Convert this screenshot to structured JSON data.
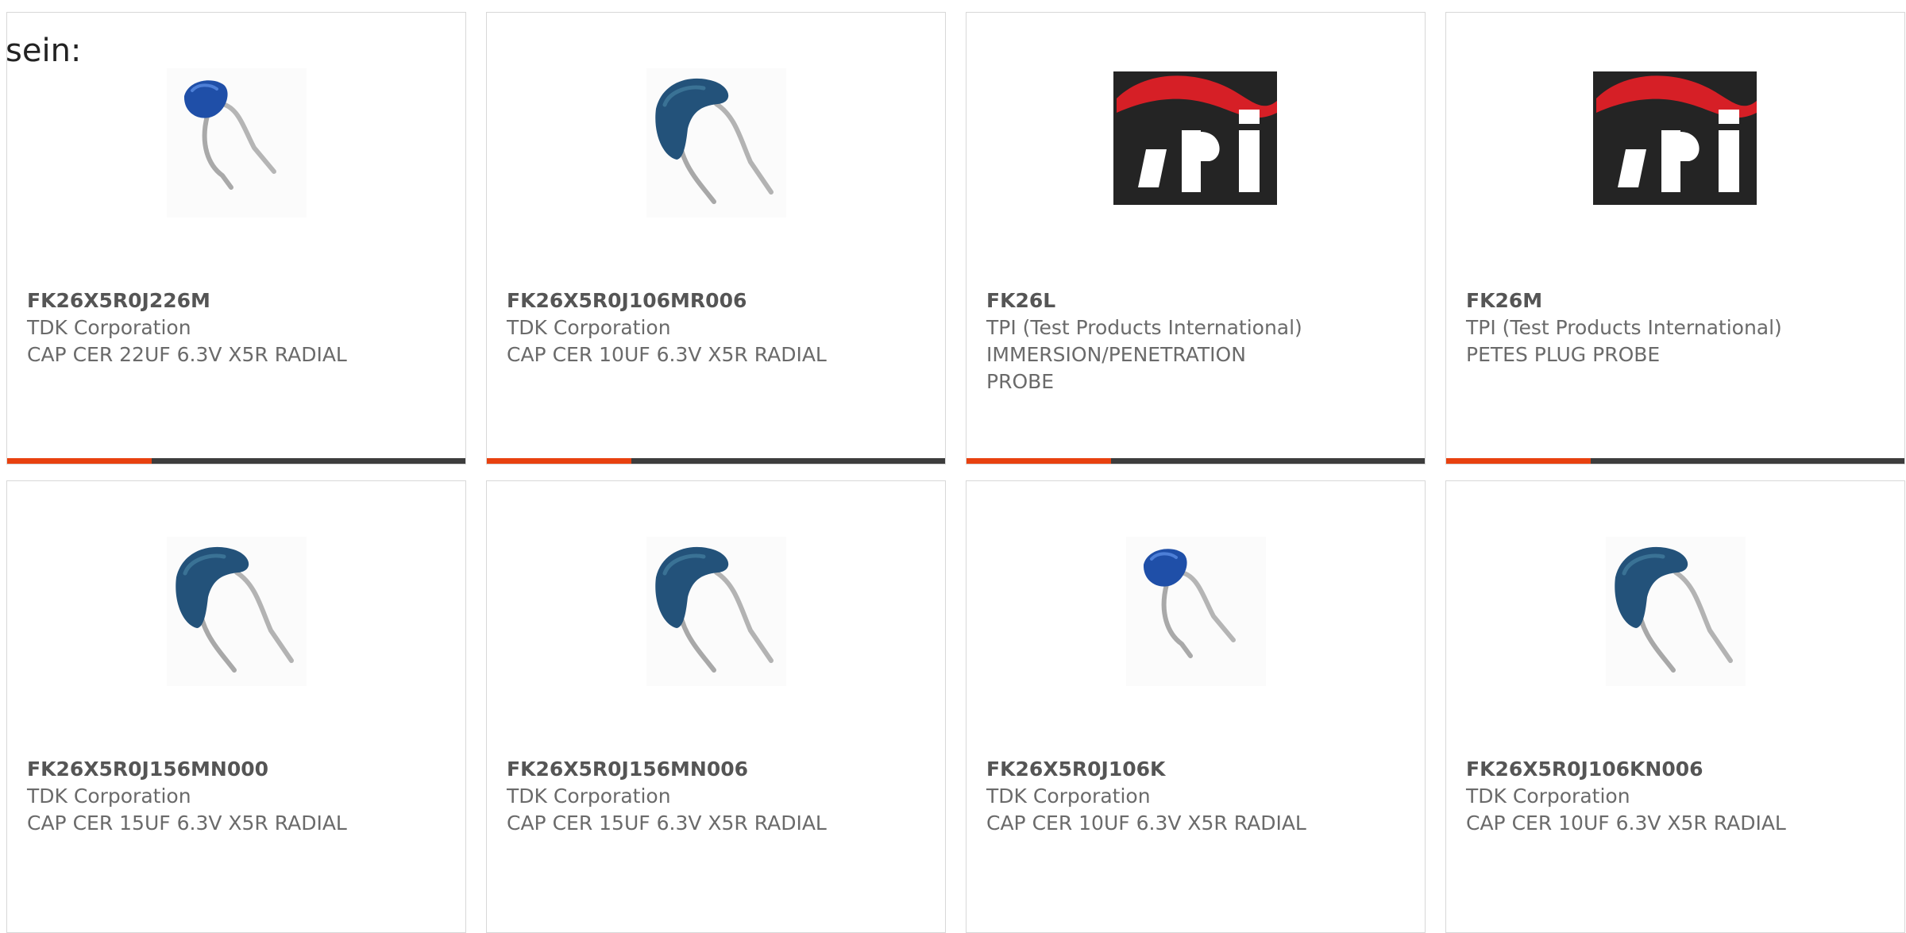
{
  "page": {
    "lead_text": "sein:"
  },
  "colors": {
    "accent": "#e8410f",
    "bar_track": "#3d3d3d",
    "capacitor_blue": "#1f4fa8",
    "capacitor_teal": "#23527a",
    "tpi_red": "#d61f26"
  },
  "products": [
    {
      "part_number": "FK26X5R0J226M",
      "manufacturer": "TDK Corporation",
      "description": [
        "CAP CER 22UF 6.3V X5R RADIAL"
      ],
      "image": "blue-radial-capacitor-small"
    },
    {
      "part_number": "FK26X5R0J106MR006",
      "manufacturer": "TDK Corporation",
      "description": [
        "CAP CER 10UF 6.3V X5R RADIAL"
      ],
      "image": "teal-radial-capacitor"
    },
    {
      "part_number": "FK26L",
      "manufacturer": "TPI (Test Products International)",
      "description": [
        "IMMERSION/PENETRATION",
        "PROBE"
      ],
      "image": "tpi-logo"
    },
    {
      "part_number": "FK26M",
      "manufacturer": "TPI (Test Products International)",
      "description": [
        "PETES PLUG PROBE"
      ],
      "image": "tpi-logo"
    },
    {
      "part_number": "FK26X5R0J156MN000",
      "manufacturer": "TDK Corporation",
      "description": [
        "CAP CER 15UF 6.3V X5R RADIAL"
      ],
      "image": "teal-radial-capacitor"
    },
    {
      "part_number": "FK26X5R0J156MN006",
      "manufacturer": "TDK Corporation",
      "description": [
        "CAP CER 15UF 6.3V X5R RADIAL"
      ],
      "image": "teal-radial-capacitor"
    },
    {
      "part_number": "FK26X5R0J106K",
      "manufacturer": "TDK Corporation",
      "description": [
        "CAP CER 10UF 6.3V X5R RADIAL"
      ],
      "image": "blue-radial-capacitor-small"
    },
    {
      "part_number": "FK26X5R0J106KN006",
      "manufacturer": "TDK Corporation",
      "description": [
        "CAP CER 10UF 6.3V X5R RADIAL"
      ],
      "image": "teal-radial-capacitor"
    }
  ]
}
